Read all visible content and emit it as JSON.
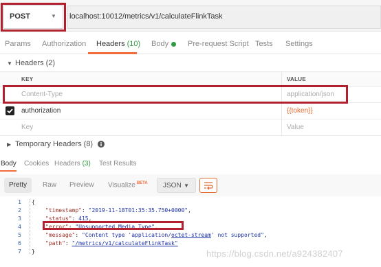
{
  "request": {
    "method": "POST",
    "url": "localhost:10012/metrics/v1/calculateFlinkTask"
  },
  "tabs": [
    {
      "label": "Params"
    },
    {
      "label": "Authorization"
    },
    {
      "label": "Headers",
      "count": "(10)"
    },
    {
      "label": "Body"
    },
    {
      "label": "Pre-request Script"
    },
    {
      "label": "Tests"
    },
    {
      "label": "Settings"
    }
  ],
  "headers_section": {
    "title": "Headers",
    "count": "(2)"
  },
  "table": {
    "col_key": "KEY",
    "col_value": "VALUE",
    "rows": [
      {
        "key": "Content-Type",
        "value": "application/json"
      },
      {
        "key": "authorization",
        "value": "{{token}}"
      },
      {
        "key": "Key",
        "value": "Value"
      }
    ]
  },
  "temp_headers": {
    "title": "Temporary Headers",
    "count": "(8)"
  },
  "response_tabs": [
    {
      "label": "Body"
    },
    {
      "label": "Cookies"
    },
    {
      "label": "Headers",
      "count": "(3)"
    },
    {
      "label": "Test Results"
    }
  ],
  "toolbar": {
    "pretty": "Pretty",
    "raw": "Raw",
    "preview": "Preview",
    "visualize": "Visualize",
    "beta": "BETA",
    "format": "JSON"
  },
  "code": {
    "line_numbers": [
      "1",
      "2",
      "3",
      "4",
      "5",
      "6",
      "7"
    ],
    "open": "{",
    "close": "}",
    "timestamp_key": "\"timestamp\"",
    "timestamp_val": "\"2019-11-18T01:35:35.750+0000\"",
    "status_key": "\"status\"",
    "status_val": "415",
    "error_key": "\"error\"",
    "error_val": "\"Unsupported Media Type\"",
    "message_key": "\"message\"",
    "message_val_a": "\"Content type 'application/",
    "message_val_b": "octet-stream",
    "message_val_c": "' not supported\"",
    "path_key": "\"path\"",
    "path_val": "\"/metrics/v1/calculateFlinkTask\""
  },
  "watermark": "https://blog.csdn.net/a924382407",
  "colors": {
    "accent": "#f26b3a",
    "highlight": "#b21f2d",
    "green": "#2e9b3f"
  }
}
